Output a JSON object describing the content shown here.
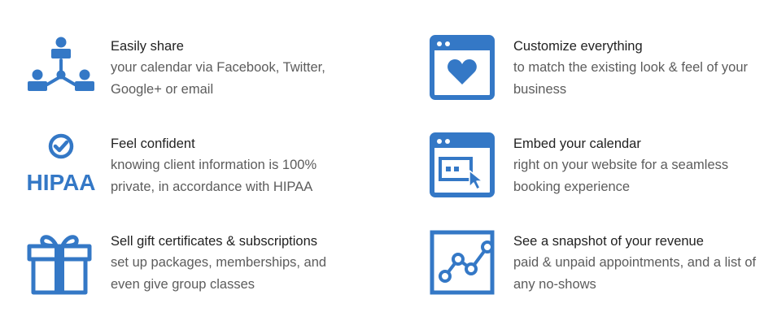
{
  "colors": {
    "accent": "#3478c6",
    "title": "#222222",
    "text": "#5c5c5c",
    "background": "#ffffff"
  },
  "features": [
    {
      "icon": "team-share-icon",
      "title": "Easily share",
      "desc": "your calendar via Facebook, Twitter, Google+ or email"
    },
    {
      "icon": "browser-heart-icon",
      "title": "Customize everything",
      "desc": "to match the existing look & feel of your business"
    },
    {
      "icon": "hipaa-check-icon",
      "icon_text": "HIPAA",
      "title": "Feel confident",
      "desc": "knowing client information is 100% private, in accordance with HIPAA"
    },
    {
      "icon": "browser-embed-icon",
      "title": "Embed your calendar",
      "desc": "right on your website for a seamless booking experience"
    },
    {
      "icon": "gift-icon",
      "title": "Sell gift certificates & subscriptions",
      "desc": "set up packages, memberships, and even give group classes"
    },
    {
      "icon": "revenue-chart-icon",
      "title": "See a snapshot of your revenue",
      "desc": "paid & unpaid appointments, and a list of any no-shows"
    }
  ]
}
